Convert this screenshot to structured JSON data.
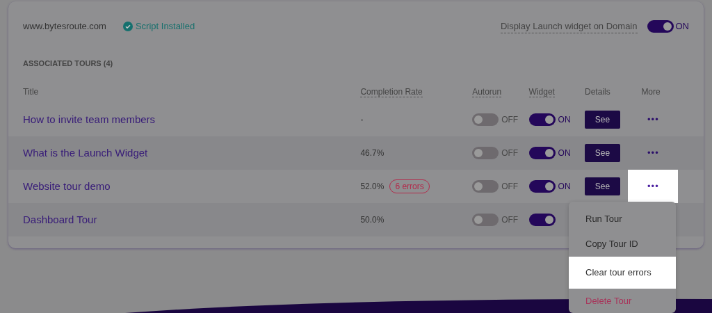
{
  "domain": {
    "name": "www.bytesroute.com",
    "status": "Script Installed",
    "display_label": "Display Launch widget on Domain",
    "display_on": true,
    "display_state": "ON"
  },
  "section_title": "ASSOCIATED TOURS (4)",
  "columns": [
    "Title",
    "Completion Rate",
    "Autorun",
    "Widget",
    "Details",
    "More"
  ],
  "rows": [
    {
      "title": "How to invite team members",
      "rate": "-",
      "autorun": false,
      "autorun_label": "OFF",
      "widget": true,
      "widget_label": "ON",
      "details": "See",
      "more": "•••",
      "highlighted": false
    },
    {
      "title": "What is the Launch Widget",
      "rate": "46.7%",
      "autorun": false,
      "autorun_label": "OFF",
      "widget": true,
      "widget_label": "ON",
      "details": "See",
      "more": "•••",
      "highlighted": false
    },
    {
      "title": "Website tour demo",
      "rate": "52.0%",
      "errors": "6 errors",
      "autorun": false,
      "autorun_label": "OFF",
      "widget": true,
      "widget_label": "ON",
      "details": "See",
      "more": "•••",
      "highlighted": true
    },
    {
      "title": "Dashboard Tour",
      "rate": "50.0%",
      "autorun": false,
      "autorun_label": "OFF",
      "widget": true
    }
  ],
  "menu": [
    {
      "label": "Run Tour",
      "kind": "normal",
      "highlighted": false
    },
    {
      "label": "Copy Tour ID",
      "kind": "normal",
      "highlighted": false
    },
    {
      "label": "Clear tour errors",
      "kind": "normal",
      "highlighted": true
    },
    {
      "label": "Delete Tour",
      "kind": "danger",
      "highlighted": false
    }
  ]
}
